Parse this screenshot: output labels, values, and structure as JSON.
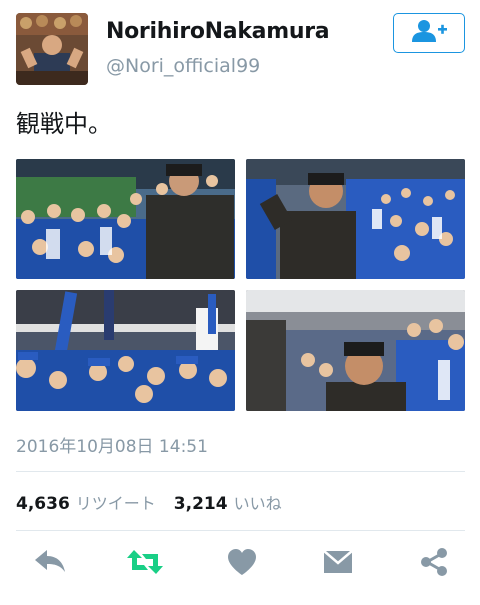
{
  "user": {
    "display_name": "NorihiroNakamura",
    "handle": "@Nori_official99"
  },
  "follow_button": {
    "icon": "add-user-icon",
    "color": "#1b95e0"
  },
  "tweet": {
    "text": "観戦中。",
    "timestamp": "2016年10月08日 14:51"
  },
  "media": [
    {
      "name": "photo-1",
      "description": "stadium-crowd-photo"
    },
    {
      "name": "photo-2",
      "description": "stadium-crowd-photo"
    },
    {
      "name": "photo-3",
      "description": "stadium-crowd-photo"
    },
    {
      "name": "photo-4",
      "description": "stadium-crowd-photo"
    }
  ],
  "stats": {
    "retweets": "4,636",
    "retweets_label": "リツイート",
    "likes": "3,214",
    "likes_label": "いいね"
  },
  "actions": [
    {
      "icon": "reply-icon",
      "color": "#8899a6"
    },
    {
      "icon": "retweet-icon",
      "color": "#19cf86"
    },
    {
      "icon": "heart-icon",
      "color": "#8899a6"
    },
    {
      "icon": "direct-message-icon",
      "color": "#8899a6"
    },
    {
      "icon": "share-icon",
      "color": "#8899a6"
    }
  ],
  "colors": {
    "accent": "#1b95e0",
    "muted": "#8899a6",
    "retweet_active": "#19cf86"
  }
}
